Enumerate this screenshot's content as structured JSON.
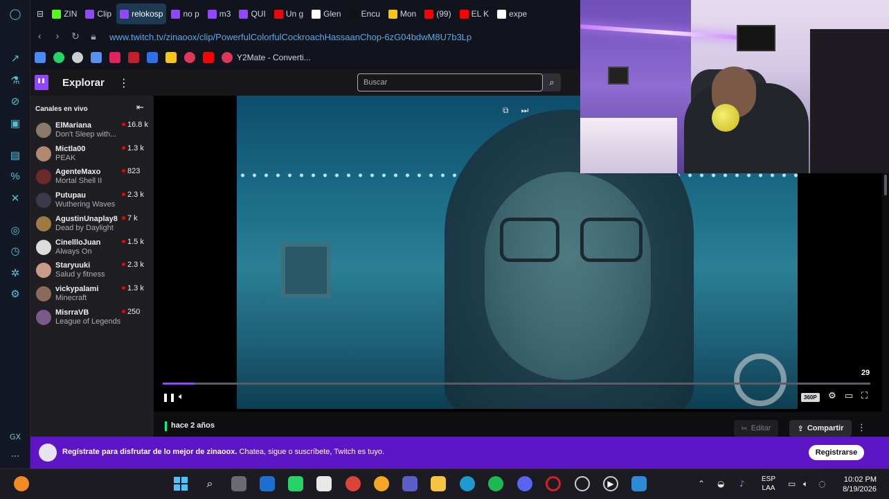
{
  "browser": {
    "tabs": [
      {
        "label": "ZIN",
        "icon": "kick-icon",
        "color": "#53fc18"
      },
      {
        "label": "Clip",
        "icon": "twitch-icon",
        "color": "#9147ff"
      },
      {
        "label": "relokosp",
        "icon": "twitch-icon",
        "color": "#9147ff",
        "active": true
      },
      {
        "label": "no p",
        "icon": "twitch-icon",
        "color": "#9147ff"
      },
      {
        "label": "m3",
        "icon": "twitch-icon",
        "color": "#9147ff"
      },
      {
        "label": "QUI",
        "icon": "twitch-icon",
        "color": "#9147ff"
      },
      {
        "label": "Un g",
        "icon": "netflix-icon",
        "color": "#e50914"
      },
      {
        "label": "Glen",
        "icon": "genius-icon",
        "color": "#ffffff"
      },
      {
        "label": "Encu",
        "icon": "tiktok-icon",
        "color": "#111111"
      },
      {
        "label": "Mon",
        "icon": "coin-icon",
        "color": "#f5c518"
      },
      {
        "label": "(99)",
        "icon": "youtube-icon",
        "color": "#ff0000"
      },
      {
        "label": "EL K",
        "icon": "youtube-icon",
        "color": "#ff0000"
      },
      {
        "label": "expe",
        "icon": "google-icon",
        "color": "#ffffff"
      }
    ],
    "url": "www.twitch.tv/zinaoox/clip/PowerfulColorfulCockroachHassaanChop-6zG04bdwM8U7b3Lp",
    "bookmark_labeled": "Y2Mate - Converti..."
  },
  "twitch": {
    "nav_title": "Explorar",
    "search_placeholder": "Buscar",
    "sidebar_title": "Canales en vivo",
    "channels": [
      {
        "name": "ElMariana",
        "game": "Don't Sleep with...",
        "viewers": "16.8 k",
        "avatar": "#8a7a6a"
      },
      {
        "name": "Mictla00",
        "game": "PEAK",
        "viewers": "1.3 k",
        "avatar": "#b08a70"
      },
      {
        "name": "AgenteMaxo",
        "game": "Mortal Shell II",
        "viewers": "823",
        "avatar": "#6a2a2a"
      },
      {
        "name": "Putupau",
        "game": "Wuthering Waves",
        "viewers": "2.3 k",
        "avatar": "#3a3a4a"
      },
      {
        "name": "AgustinUnaplay8",
        "game": "Dead by Daylight",
        "viewers": "7 k",
        "avatar": "#a07a40"
      },
      {
        "name": "CinellloJuan",
        "game": "Always On",
        "viewers": "1.5 k",
        "avatar": "#dcdcdc"
      },
      {
        "name": "Staryuuki",
        "game": "Salud y fitness",
        "viewers": "2.3 k",
        "avatar": "#c89a88"
      },
      {
        "name": "vickypalami",
        "game": "Minecraft",
        "viewers": "1.3 k",
        "avatar": "#8a6a5a"
      },
      {
        "name": "MisrraVB",
        "game": "League of Legends",
        "viewers": "250",
        "avatar": "#7a5a8a"
      }
    ],
    "player": {
      "counter": "29",
      "quality": "360P",
      "progress_fraction": 0.045
    },
    "clip_age": "hace 2 años",
    "edit_label": "Editar",
    "share_label": "Compartir",
    "promo_bold": "Regístrate para disfrutar de lo mejor de zinaoox.",
    "promo_rest": "Chatea, sigue o suscríbete, Twitch es tuyo.",
    "register_label": "Registrarse"
  },
  "taskbar": {
    "language": "ESP",
    "layout": "LAA",
    "time": "10:02 PM",
    "date": "8/19/2026",
    "opera_gx_label": "GX"
  }
}
